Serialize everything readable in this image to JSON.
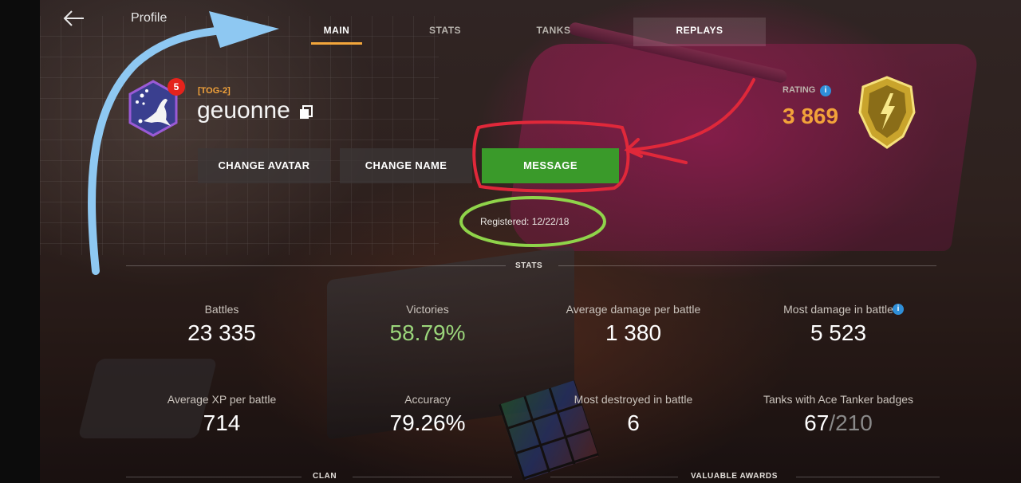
{
  "header": {
    "title": "Profile",
    "tabs": [
      {
        "label": "MAIN",
        "active": true
      },
      {
        "label": "STATS",
        "active": false
      },
      {
        "label": "TANKS",
        "active": false
      },
      {
        "label": "REPLAYS",
        "active": false
      }
    ]
  },
  "player": {
    "clan_tag": "[TOG-2]",
    "name": "geuonne",
    "notification_count": "5",
    "registered": "Registered: 12/22/18"
  },
  "actions": {
    "change_avatar": "CHANGE AVATAR",
    "change_name": "CHANGE NAME",
    "message": "MESSAGE"
  },
  "rating": {
    "label": "RATING",
    "value": "3 869"
  },
  "stats": {
    "section_title": "STATS",
    "items": [
      {
        "label": "Battles",
        "value": "23 335"
      },
      {
        "label": "Victories",
        "value": "58.79%"
      },
      {
        "label": "Average damage per battle",
        "value": "1 380"
      },
      {
        "label": "Most damage in battle",
        "value": "5 523"
      },
      {
        "label": "Average XP per battle",
        "value": "714"
      },
      {
        "label": "Accuracy",
        "value": "79.26%"
      },
      {
        "label": "Most destroyed in battle",
        "value": "6"
      },
      {
        "label": "Tanks with Ace Tanker badges",
        "value": "67",
        "total": "/210"
      }
    ]
  },
  "sections": {
    "clan": "CLAN",
    "valuable_awards": "VALUABLE AWARDS"
  },
  "colors": {
    "accent_orange": "#f2a23a",
    "message_green": "#3a9a2a",
    "victory_green": "#9bd67b",
    "info_blue": "#2f8fd8",
    "annotation_blue": "#8ec8f2",
    "annotation_red": "#e0283a",
    "annotation_green": "#8fd44a"
  },
  "icons": {
    "back": "arrow-left-icon",
    "copy": "copy-icon",
    "info": "info-icon",
    "avatar": "kangaroo-emblem-icon",
    "rating_badge": "rating-shield-icon"
  }
}
